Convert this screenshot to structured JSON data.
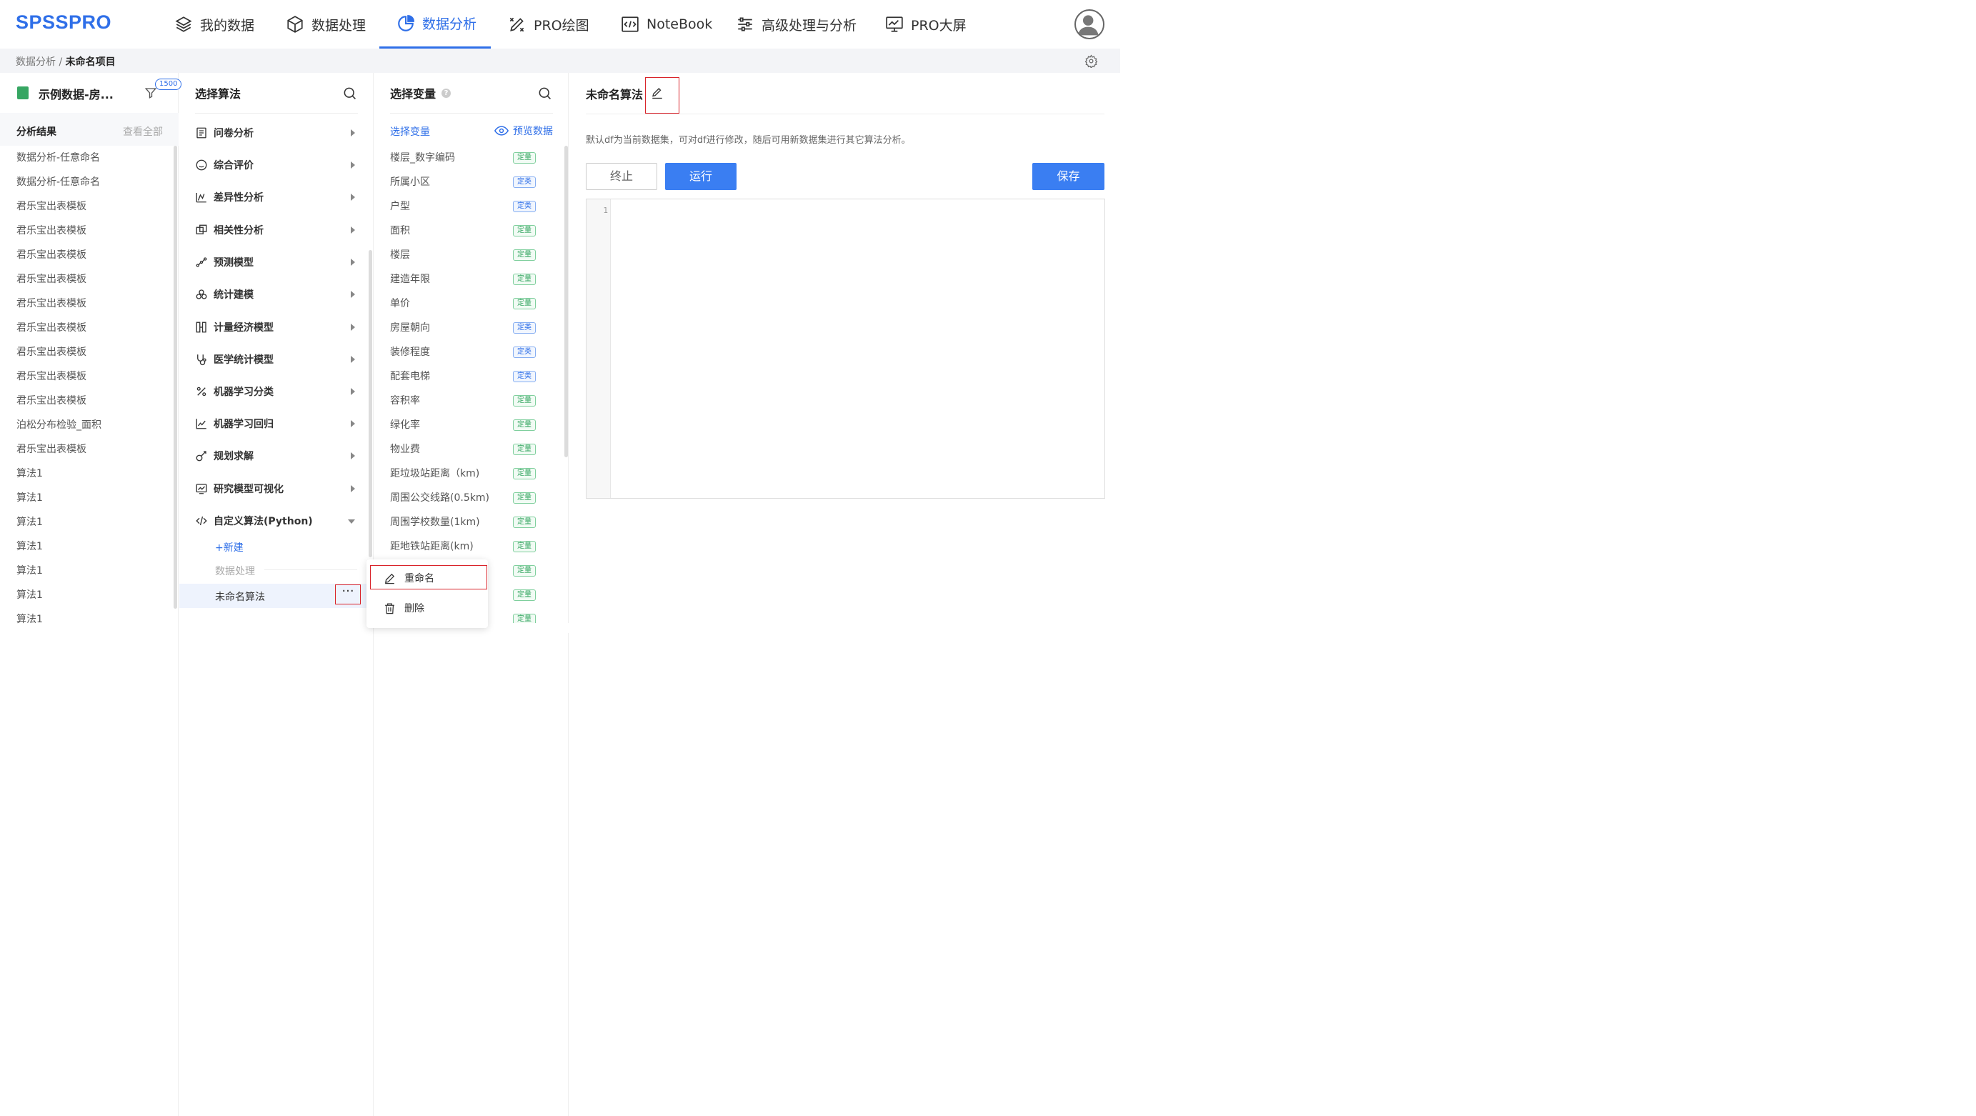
{
  "app": {
    "logo": "SPSSPRO"
  },
  "nav": [
    {
      "label": "我的数据",
      "icon": "layers-icon",
      "active": false
    },
    {
      "label": "数据处理",
      "icon": "cube-icon",
      "active": false
    },
    {
      "label": "数据分析",
      "icon": "pie-chart-icon",
      "active": true
    },
    {
      "label": "PRO绘图",
      "icon": "draw-icon",
      "active": false
    },
    {
      "label": "NoteBook",
      "icon": "code-window-icon",
      "active": false
    },
    {
      "label": "高级处理与分析",
      "icon": "sliders-icon",
      "active": false
    },
    {
      "label": "PRO大屏",
      "icon": "dashboard-icon",
      "active": false
    }
  ],
  "breadcrumb": {
    "parent": "数据分析",
    "separator": "/",
    "current": "未命名项目"
  },
  "dataset": {
    "name": "示例数据-房...",
    "filter_count": "1500"
  },
  "results": {
    "title": "分析结果",
    "view_all": "查看全部",
    "items": [
      "数据分析-任意命名",
      "数据分析-任意命名",
      "君乐宝出表模板",
      "君乐宝出表模板",
      "君乐宝出表模板",
      "君乐宝出表模板",
      "君乐宝出表模板",
      "君乐宝出表模板",
      "君乐宝出表模板",
      "君乐宝出表模板",
      "君乐宝出表模板",
      "泊松分布检验_面积",
      "君乐宝出表模板",
      "算法1",
      "算法1",
      "算法1",
      "算法1",
      "算法1",
      "算法1",
      "算法1"
    ]
  },
  "algorithms": {
    "title": "选择算法",
    "items": [
      {
        "label": "问卷分析",
        "icon": "survey-icon"
      },
      {
        "label": "综合评价",
        "icon": "smile-icon"
      },
      {
        "label": "差异性分析",
        "icon": "difference-icon"
      },
      {
        "label": "相关性分析",
        "icon": "correlation-icon"
      },
      {
        "label": "预测模型",
        "icon": "prediction-icon"
      },
      {
        "label": "统计建模",
        "icon": "circles-icon"
      },
      {
        "label": "计量经济模型",
        "icon": "econometric-icon"
      },
      {
        "label": "医学统计模型",
        "icon": "stethoscope-icon"
      },
      {
        "label": "机器学习分类",
        "icon": "percent-icon"
      },
      {
        "label": "机器学习回归",
        "icon": "regression-icon"
      },
      {
        "label": "规划求解",
        "icon": "solver-icon"
      },
      {
        "label": "研究模型可视化",
        "icon": "visual-icon"
      },
      {
        "label": "自定义算法(Python)",
        "icon": "code-icon"
      }
    ],
    "new_label": "+新建",
    "group_label": "数据处理",
    "selected_label": "未命名算法",
    "more_label": "···"
  },
  "variables": {
    "title": "选择变量",
    "subtitle": "选择变量",
    "preview_label": "预览数据",
    "items": [
      {
        "name": "楼层_数字编码",
        "tag": "定量",
        "kind": "q"
      },
      {
        "name": "所属小区",
        "tag": "定类",
        "kind": "c"
      },
      {
        "name": "户型",
        "tag": "定类",
        "kind": "c"
      },
      {
        "name": "面积",
        "tag": "定量",
        "kind": "q"
      },
      {
        "name": "楼层",
        "tag": "定量",
        "kind": "q"
      },
      {
        "name": "建造年限",
        "tag": "定量",
        "kind": "q"
      },
      {
        "name": "单价",
        "tag": "定量",
        "kind": "q"
      },
      {
        "name": "房屋朝向",
        "tag": "定类",
        "kind": "c"
      },
      {
        "name": "装修程度",
        "tag": "定类",
        "kind": "c"
      },
      {
        "name": "配套电梯",
        "tag": "定类",
        "kind": "c"
      },
      {
        "name": "容积率",
        "tag": "定量",
        "kind": "q"
      },
      {
        "name": "绿化率",
        "tag": "定量",
        "kind": "q"
      },
      {
        "name": "物业费",
        "tag": "定量",
        "kind": "q"
      },
      {
        "name": "距垃圾站距离（km)",
        "tag": "定量",
        "kind": "q"
      },
      {
        "name": "周围公交线路(0.5km)",
        "tag": "定量",
        "kind": "q"
      },
      {
        "name": "周围学校数量(1km)",
        "tag": "定量",
        "kind": "q"
      },
      {
        "name": "距地铁站距离(km)",
        "tag": "定量",
        "kind": "q"
      },
      {
        "name": "",
        "tag": "定量",
        "kind": "q"
      },
      {
        "name": "",
        "tag": "定量",
        "kind": "q"
      },
      {
        "name": "",
        "tag": "定量",
        "kind": "q"
      }
    ]
  },
  "context_menu": {
    "rename": "重命名",
    "delete": "删除"
  },
  "editor": {
    "algorithm_name": "未命名算法",
    "hint": "默认df为当前数据集，可对df进行修改，随后可用新数据集进行其它算法分析。",
    "stop_label": "终止",
    "run_label": "运行",
    "save_label": "保存",
    "line_number": "1"
  }
}
